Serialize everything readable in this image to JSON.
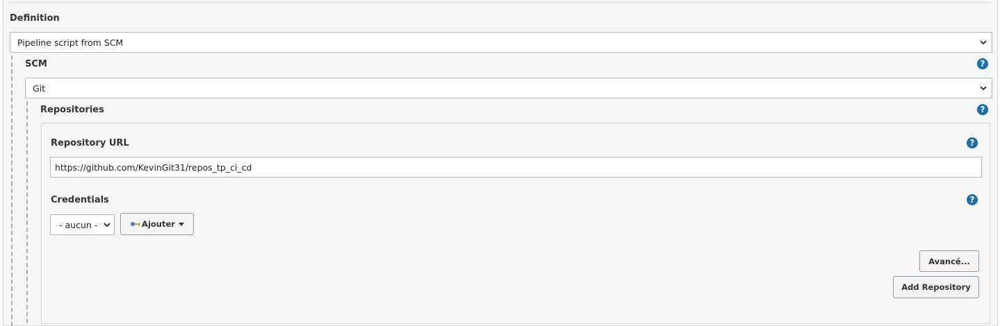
{
  "definition": {
    "label": "Definition",
    "select_value": "Pipeline script from SCM"
  },
  "scm": {
    "label": "SCM",
    "select_value": "Git",
    "help": "?"
  },
  "repositories": {
    "label": "Repositories",
    "help": "?",
    "repository_url": {
      "label": "Repository URL",
      "value": "https://github.com/KevinGit31/repos_tp_ci_cd",
      "help": "?"
    },
    "credentials": {
      "label": "Credentials",
      "select_value": "- aucun -",
      "add_button_label": "Ajouter",
      "help": "?"
    },
    "advanced_button_label": "Avancé...",
    "add_repository_button_label": "Add Repository"
  },
  "icons": {
    "help": "help-icon",
    "dropdown": "chevron-down-icon",
    "key": "key-icon",
    "caret": "caret-down-icon"
  },
  "colors": {
    "help_icon": "#1e6ea3",
    "panel_background": "#f6f6f6",
    "border": "#b4b4b4"
  }
}
